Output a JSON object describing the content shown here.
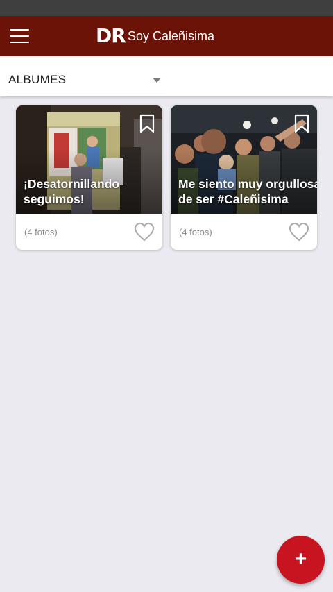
{
  "header": {
    "logo_text": "DR",
    "title": "Soy Caleñisima"
  },
  "filter": {
    "selected": "ALBUMES"
  },
  "albums": [
    {
      "title": "¡Desatornillando\nseguimos!",
      "photo_count": "(4 fotos)"
    },
    {
      "title": "Me siento muy orgullosa\nde ser #Caleñisima",
      "photo_count": "(4 fotos)"
    }
  ],
  "fab": {
    "label": "+"
  },
  "colors": {
    "appbar": "#6a1306",
    "statusbar": "#3f3f3f",
    "background": "#ebeaf0",
    "fab": "#c81420"
  },
  "icons": {
    "menu": "menu-icon",
    "dropdown": "chevron-down-icon",
    "bookmark": "bookmark-icon",
    "like": "heart-icon",
    "add": "plus-icon"
  }
}
